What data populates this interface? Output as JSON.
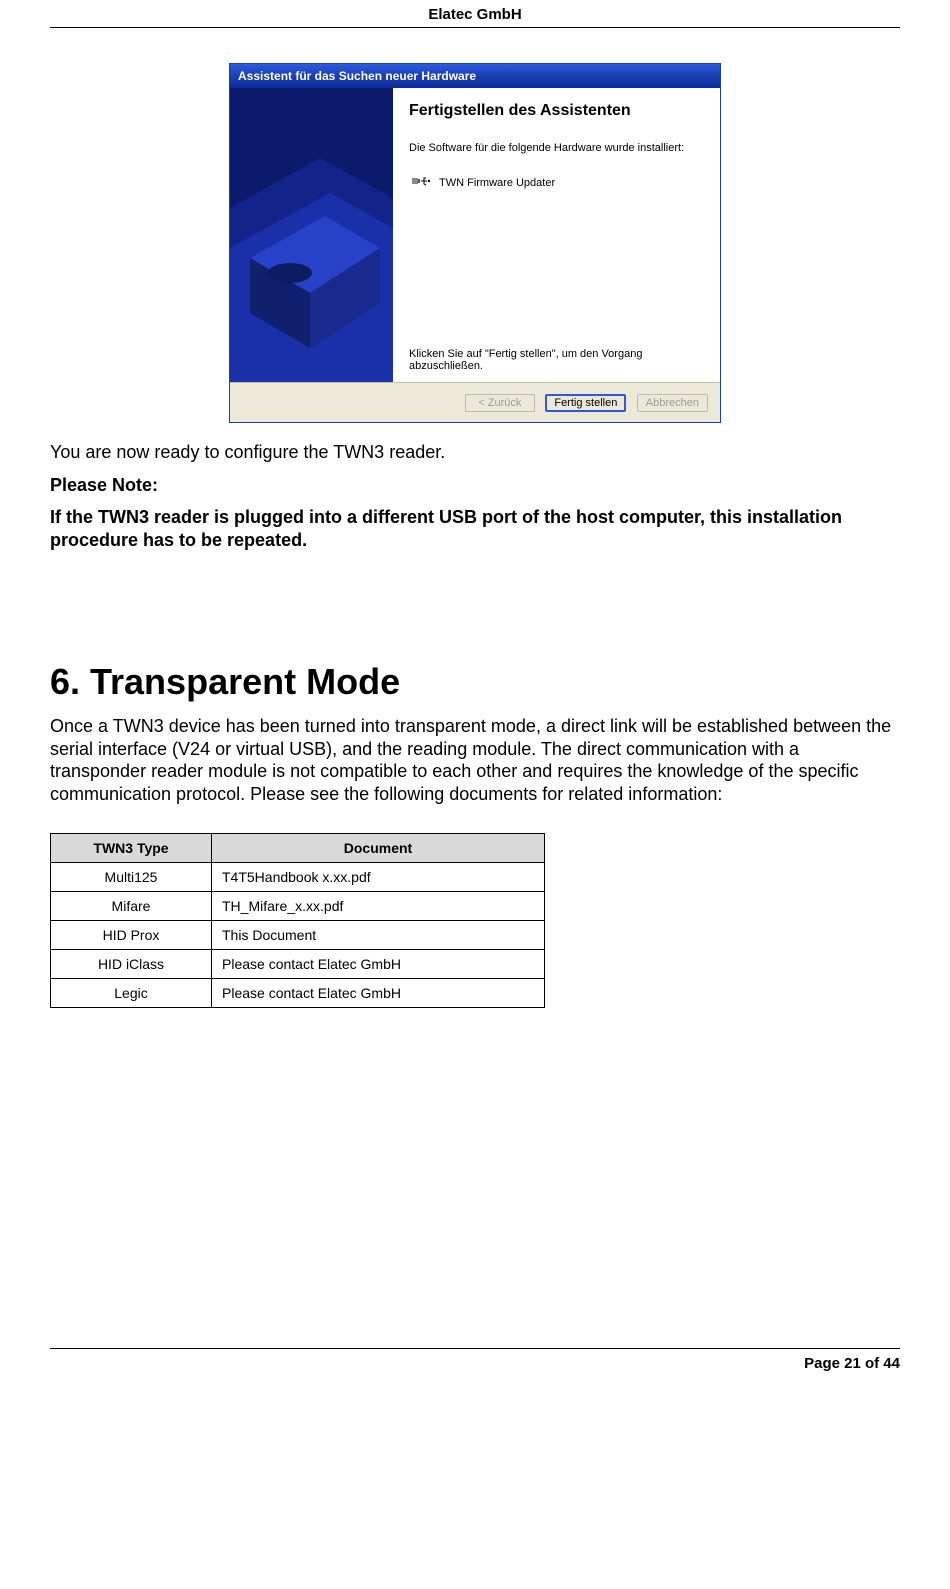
{
  "header": {
    "title": "Elatec GmbH"
  },
  "wizard": {
    "title": "Assistent für das Suchen neuer Hardware",
    "main_title": "Fertigstellen des Assistenten",
    "subtitle": "Die Software für die folgende Hardware wurde installiert:",
    "device_name": "TWN Firmware Updater",
    "footer_text": "Klicken Sie auf \"Fertig stellen\", um den Vorgang abzuschließen.",
    "buttons": {
      "back": "< Zurück",
      "finish": "Fertig stellen",
      "cancel": "Abbrechen"
    }
  },
  "content": {
    "ready_line": "You are now ready to configure the TWN3 reader.",
    "please_note": "Please Note:",
    "note_text": "If the TWN3 reader is plugged into a different USB port of the host computer, this installation procedure has to be repeated.",
    "section_heading": "6. Transparent Mode",
    "section_para": "Once a TWN3 device has been turned into transparent mode, a direct link will be established between the serial interface (V24 or virtual USB), and the reading module. The direct communication with a transponder reader module is not compatible to each other and requires the knowledge of the specific communication protocol. Please see the following documents for related information:"
  },
  "table": {
    "headers": {
      "col1": "TWN3 Type",
      "col2": "Document"
    },
    "rows": [
      {
        "type": "Multi125",
        "doc": "T4T5Handbook x.xx.pdf"
      },
      {
        "type": "Mifare",
        "doc": "TH_Mifare_x.xx.pdf"
      },
      {
        "type": "HID Prox",
        "doc": "This Document"
      },
      {
        "type": "HID iClass",
        "doc": "Please contact Elatec GmbH"
      },
      {
        "type": "Legic",
        "doc": "Please contact Elatec GmbH"
      }
    ]
  },
  "footer": {
    "page_line": "Page 21 of 44"
  }
}
